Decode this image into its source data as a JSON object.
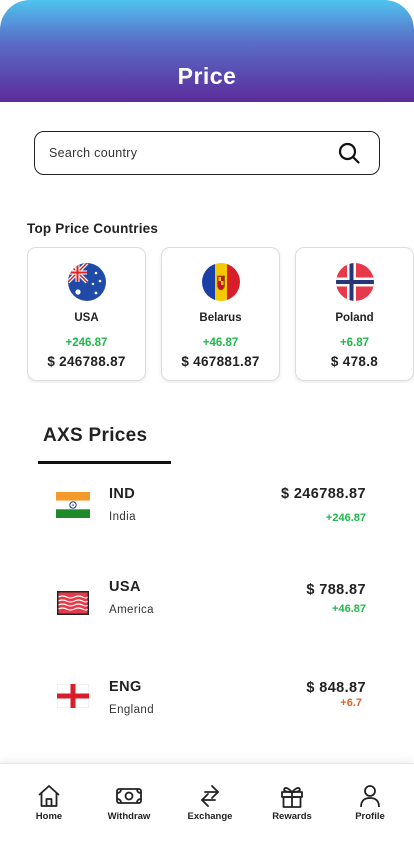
{
  "header": {
    "title": "Price"
  },
  "search": {
    "placeholder": "Search country",
    "icon": "search-icon"
  },
  "top_countries": {
    "title": "Top Price Countries",
    "cards": [
      {
        "name": "USA",
        "delta": "+246.87",
        "price": "$ 246788.87",
        "flag": "australia-flag-icon"
      },
      {
        "name": "Belarus",
        "delta": "+46.87",
        "price": "$ 467881.87",
        "flag": "andorra-flag-icon"
      },
      {
        "name": "Poland",
        "delta": "+6.87",
        "price": "$ 478.8",
        "flag": "norway-flag-icon"
      }
    ]
  },
  "axs": {
    "title": "AXS Prices",
    "rows": [
      {
        "code": "IND",
        "country": "India",
        "price": "$ 246788.87",
        "delta": "+246.87",
        "delta_color": "#1fb84a"
      },
      {
        "code": "USA",
        "country": "America",
        "price": "$ 788.87",
        "delta": "+46.87",
        "delta_color": "#1fb84a"
      },
      {
        "code": "ENG",
        "country": "England",
        "price": "$ 848.87",
        "delta": "+6.7",
        "delta_color": "#e0652a"
      }
    ]
  },
  "nav": {
    "items": [
      {
        "label": "Home",
        "icon": "home-icon"
      },
      {
        "label": "Withdraw",
        "icon": "money-icon"
      },
      {
        "label": "Exchange",
        "icon": "exchange-icon"
      },
      {
        "label": "Rewards",
        "icon": "gift-icon"
      },
      {
        "label": "Profile",
        "icon": "profile-icon"
      }
    ]
  },
  "colors": {
    "positive": "#1fb84a",
    "negative": "#e0652a",
    "header_top": "#4fc3ee",
    "header_bottom": "#5b2b9a"
  }
}
